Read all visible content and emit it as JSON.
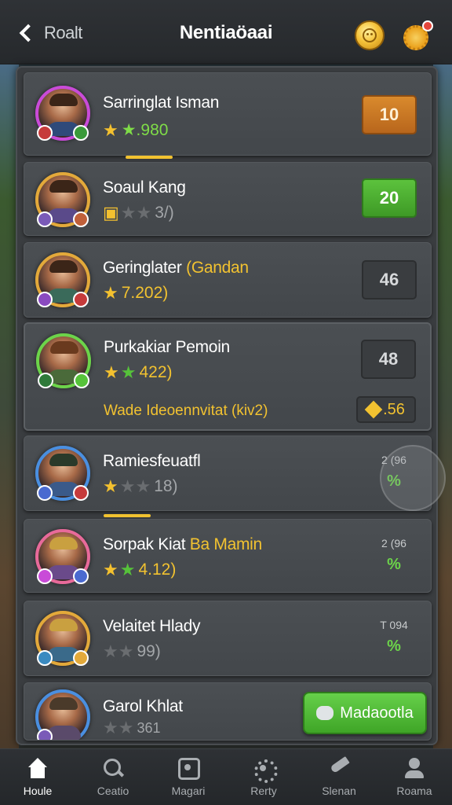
{
  "header": {
    "back_label": "Roalt",
    "title": "Nentiaöaai"
  },
  "players": [
    {
      "name": "Sarringlat Isman",
      "name_accent": "",
      "rating": "★.980",
      "stars": [
        "gold",
        "green"
      ],
      "rating_style": "green",
      "score_mini": "",
      "score": "10",
      "score_style": "orange",
      "avatar_ring": "#c94bd8"
    },
    {
      "name": "Soaul Kang",
      "name_accent": "",
      "rating": "3/)",
      "stars": [
        "gold",
        "grey",
        "grey"
      ],
      "rating_style": "grey",
      "score_mini": "",
      "score": "20",
      "score_style": "green",
      "avatar_ring": "#e3a93a"
    },
    {
      "name": "Geringlater ",
      "name_accent": "(Gandan",
      "rating": "7.202)",
      "stars": [
        "gold",
        "grey"
      ],
      "rating_style": "gold",
      "score_mini": "",
      "score": "46",
      "score_style": "dark",
      "avatar_ring": "#e3a93a"
    },
    {
      "name": "Purkakiar Pemoin",
      "name_accent": "",
      "rating": "422)",
      "stars": [
        "gold",
        "green"
      ],
      "rating_style": "gold",
      "score_mini": "",
      "score": "48",
      "score_style": "dark",
      "avatar_ring": "#6cd44a",
      "sub_line": "Wade Ideoennvitat (kiv2)",
      "gem_value": ".56"
    },
    {
      "name": "Ramiesfeuatfl",
      "name_accent": "",
      "rating": "18)",
      "stars": [
        "gold",
        "grey",
        "grey"
      ],
      "rating_style": "grey",
      "side_top": "2 (96",
      "side_sym": "%",
      "avatar_ring": "#4a8fe0"
    },
    {
      "name": "Sorpak Kiat ",
      "name_accent": "Ba Mamin",
      "rating": "4.12)",
      "stars": [
        "gold",
        "green"
      ],
      "rating_style": "gold",
      "side_top": "2 (96",
      "side_sym": "%",
      "avatar_ring": "#e86a9a"
    },
    {
      "name": "Velaitet Hlady",
      "name_accent": "",
      "rating": "99)",
      "stars": [
        "grey",
        "grey"
      ],
      "rating_style": "grey",
      "side_top": "T 094",
      "side_sym": "%",
      "avatar_ring": "#e3a93a"
    },
    {
      "name": "Garol Khlat",
      "name_accent": "",
      "rating": "361",
      "stars": [
        "grey",
        "grey"
      ],
      "rating_style": "grey",
      "avatar_ring": "#4a8fe0"
    }
  ],
  "cta": {
    "label": "Madaootla"
  },
  "nav": [
    {
      "label": "Houle",
      "icon": "home-icon"
    },
    {
      "label": "Ceatio",
      "icon": "search-icon"
    },
    {
      "label": "Magari",
      "icon": "match-icon"
    },
    {
      "label": "Rerty",
      "icon": "party-icon"
    },
    {
      "label": "Slenan",
      "icon": "social-icon"
    },
    {
      "label": "Roama",
      "icon": "profile-icon"
    }
  ],
  "colors": {
    "accent_gold": "#f2c230",
    "accent_green": "#56c23a",
    "score_orange": "#d98a2d"
  }
}
